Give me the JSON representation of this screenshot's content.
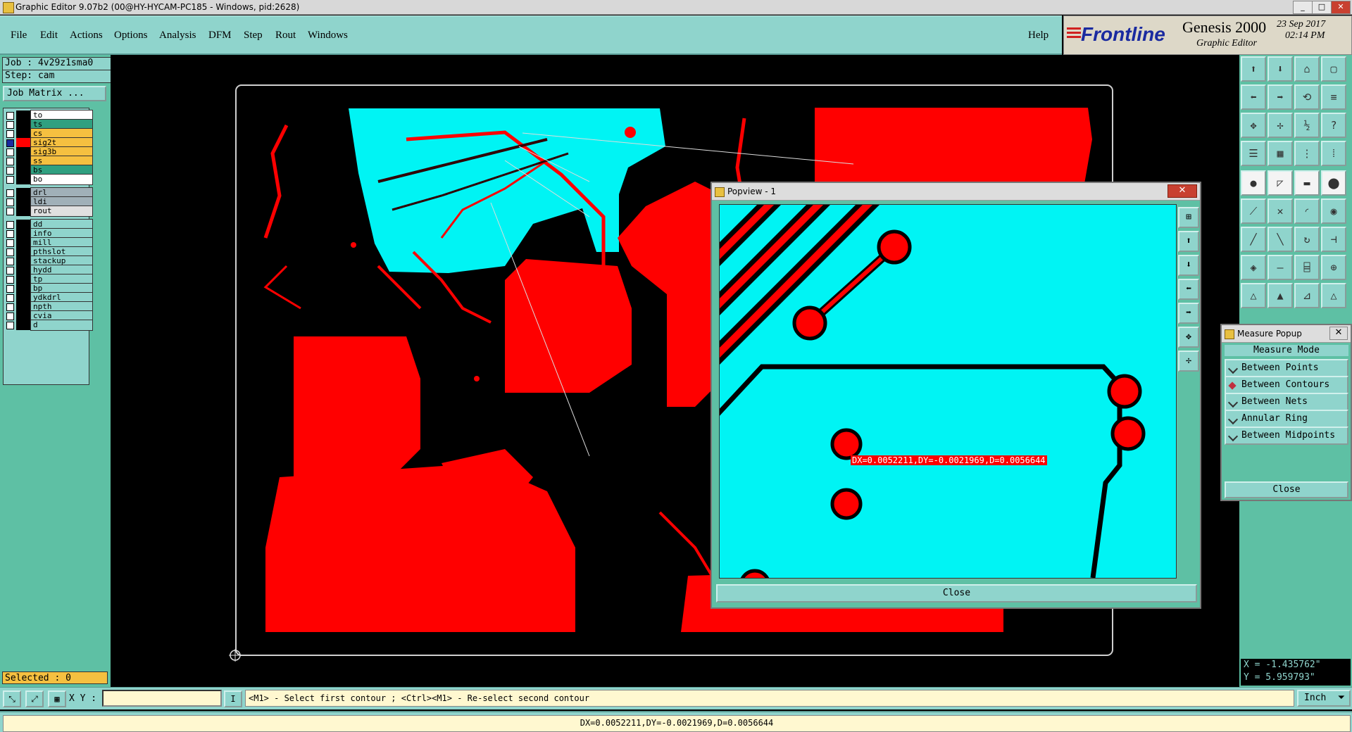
{
  "window": {
    "title": "Graphic Editor 9.07b2 (00@HY-HYCAM-PC185 - Windows, pid:2628)",
    "minimize": "_",
    "maximize": "□",
    "close": "✕"
  },
  "menu": {
    "items": [
      "File",
      "Edit",
      "Actions",
      "Options",
      "Analysis",
      "DFM",
      "Step",
      "Rout",
      "Windows"
    ],
    "help": "Help"
  },
  "brand": {
    "logo": "Frontline",
    "product": "Genesis 2000",
    "subtitle": "Graphic Editor",
    "date": "23 Sep 2017",
    "time": "02:14 PM"
  },
  "job": {
    "job_line": "Job : 4v29z1sma0",
    "step_line": "Step: cam",
    "matrix_button": "Job Matrix ..."
  },
  "layers": [
    {
      "name": "to",
      "color": "#ffffff",
      "checked": false
    },
    {
      "name": "ts",
      "color": "#30a080",
      "checked": false
    },
    {
      "name": "cs",
      "color": "#f5c040",
      "checked": false
    },
    {
      "name": "sig2t",
      "color": "#f5c040",
      "checked": true
    },
    {
      "name": "sig3b",
      "color": "#f5c040",
      "checked": false
    },
    {
      "name": "ss",
      "color": "#f5c040",
      "checked": false
    },
    {
      "name": "bs",
      "color": "#30a080",
      "checked": false
    },
    {
      "name": "bo",
      "color": "#ffffff",
      "checked": false
    },
    {
      "name": "drl",
      "color": "#a0b0b8",
      "checked": false
    },
    {
      "name": "ldi",
      "color": "#a0b0b8",
      "checked": false
    },
    {
      "name": "rout",
      "color": "#e0e0e0",
      "checked": false
    },
    {
      "name": "dd",
      "color": "#8fd4cc",
      "checked": false
    },
    {
      "name": "info",
      "color": "#8fd4cc",
      "checked": false
    },
    {
      "name": "mill",
      "color": "#8fd4cc",
      "checked": false
    },
    {
      "name": "pthslot",
      "color": "#8fd4cc",
      "checked": false
    },
    {
      "name": "stackup",
      "color": "#8fd4cc",
      "checked": false
    },
    {
      "name": "hydd",
      "color": "#8fd4cc",
      "checked": false
    },
    {
      "name": "tp",
      "color": "#8fd4cc",
      "checked": false
    },
    {
      "name": "bp",
      "color": "#8fd4cc",
      "checked": false
    },
    {
      "name": "ydkdrl",
      "color": "#8fd4cc",
      "checked": false
    },
    {
      "name": "npth",
      "color": "#8fd4cc",
      "checked": false
    },
    {
      "name": "cvia",
      "color": "#8fd4cc",
      "checked": false
    },
    {
      "name": "d",
      "color": "#8fd4cc",
      "checked": false
    }
  ],
  "selected": "Selected : 0",
  "popview": {
    "title": "Popview - 1",
    "close_label": "Close",
    "measure_readout": "DX=0.0052211,DY=-0.0021969,D=0.0056644"
  },
  "measure_popup": {
    "title": "Measure Popup",
    "heading": "Measure Mode",
    "options": [
      "Between Points",
      "Between Contours",
      "Between Nets",
      "Annular Ring",
      "Between Midpoints"
    ],
    "selected_index": 1,
    "close_label": "Close"
  },
  "coords": {
    "x": "X = -1.435762\"",
    "y": "Y = 5.959793\""
  },
  "cmdbar": {
    "xy_label": "X Y :",
    "prompt": "<M1> - Select first contour ; <Ctrl><M1> - Re-select second contour",
    "units": "Inch"
  },
  "status": "DX=0.0052211,DY=-0.0021969,D=0.0056644",
  "colors": {
    "panel": "#8fd4cc",
    "panel_dark": "#5ec0a4",
    "copper": "#ff0000",
    "highlight": "#00f4f4"
  }
}
